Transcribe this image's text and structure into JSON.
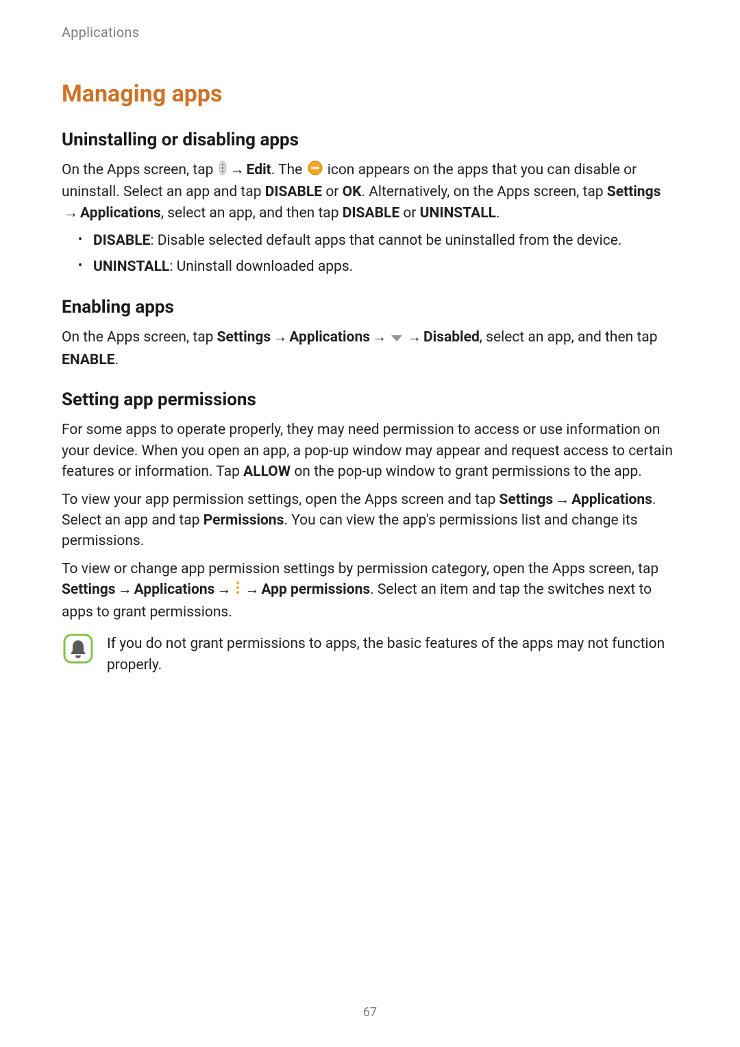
{
  "header": {
    "running": "Applications"
  },
  "title": "Managing apps",
  "s1": {
    "heading": "Uninstalling or disabling apps",
    "p1a": "On the Apps screen, tap ",
    "arrow": " → ",
    "edit": "Edit",
    "p1b": ". The ",
    "p1c": " icon appears on the apps that you can disable or uninstall. Select an app and tap ",
    "disable": "DISABLE",
    "or": " or ",
    "ok": "OK",
    "p1d": ". Alternatively, on the Apps screen, tap ",
    "settings": "Settings",
    "applications": "Applications",
    "p1e": ", select an app, and then tap ",
    "uninstall": "UNINSTALL",
    "period": ".",
    "li1a": "DISABLE",
    "li1b": ": Disable selected default apps that cannot be uninstalled from the device.",
    "li2a": "UNINSTALL",
    "li2b": ": Uninstall downloaded apps."
  },
  "s2": {
    "heading": "Enabling apps",
    "p1a": "On the Apps screen, tap ",
    "settings": "Settings",
    "arrow": " → ",
    "applications": "Applications",
    "disabled": "Disabled",
    "p1b": ", select an app, and then tap ",
    "enable": "ENABLE",
    "period": "."
  },
  "s3": {
    "heading": "Setting app permissions",
    "p1a": "For some apps to operate properly, they may need permission to access or use information on your device. When you open an app, a pop-up window may appear and request access to certain features or information. Tap ",
    "allow": "ALLOW",
    "p1b": " on the pop-up window to grant permissions to the app.",
    "p2a": "To view your app permission settings, open the Apps screen and tap ",
    "settings": "Settings",
    "arrow": " → ",
    "applications": "Applications",
    "p2b": ". Select an app and tap ",
    "permissions": "Permissions",
    "p2c": ". You can view the app's permissions list and change its permissions.",
    "p3a": "To view or change app permission settings by permission category, open the Apps screen, tap ",
    "app_permissions": "App permissions",
    "p3b": ". Select an item and tap the switches next to apps to grant permissions.",
    "note": "If you do not grant permissions to apps, the basic features of the apps may not function properly."
  },
  "page_number": "67"
}
